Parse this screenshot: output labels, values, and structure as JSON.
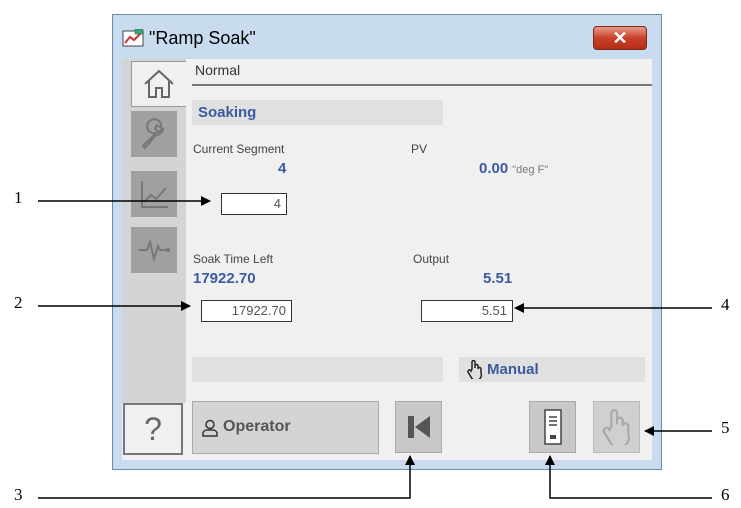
{
  "window": {
    "title": "\"Ramp Soak\"",
    "close_label": "✕"
  },
  "status": {
    "mode_text": "Normal",
    "state_text": "Soaking"
  },
  "segment": {
    "label": "Current Segment",
    "value": "4",
    "entry_value": "4"
  },
  "pv": {
    "label": "PV",
    "value": "0.00",
    "unit": "\"deg F\""
  },
  "soak": {
    "label": "Soak Time Left",
    "value": "17922.70",
    "entry_value": "17922.70"
  },
  "output": {
    "label": "Output",
    "value": "5.51",
    "entry_value": "5.51"
  },
  "mode": {
    "label": "Manual"
  },
  "footer": {
    "help_label": "?",
    "operator_label": "Operator"
  },
  "callouts": [
    "1",
    "2",
    "3",
    "4",
    "5",
    "6"
  ],
  "colors": {
    "value_blue": "#3a5ba0",
    "frame": "#c9dcef",
    "close_red": "#c9412a"
  },
  "icons": {
    "title": "window-app-icon",
    "nav": [
      "home-icon",
      "wrench-icon",
      "trend-icon",
      "pulse-icon"
    ],
    "mode": "hand-icon",
    "operator": "user-icon",
    "rewind": "skip-back-icon",
    "faceplate": "faceplate-icon",
    "hand_button": "hand-icon"
  }
}
